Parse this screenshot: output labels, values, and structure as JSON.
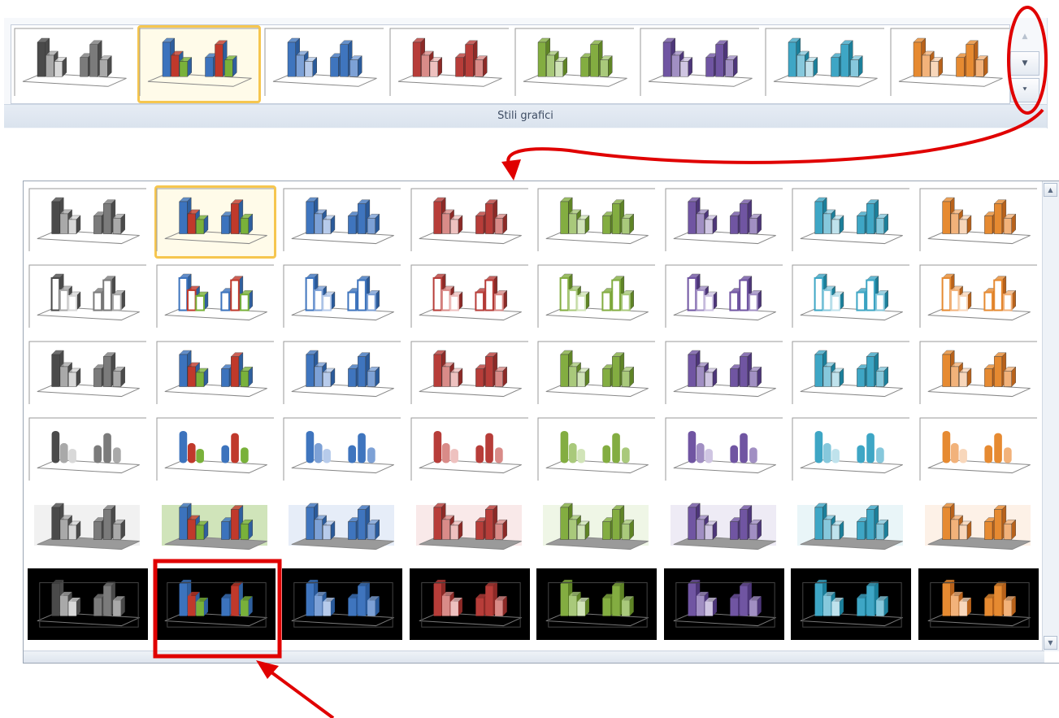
{
  "ribbon": {
    "group_caption": "Stili grafici",
    "selected_index": 1,
    "scroll_up_icon": "▲",
    "scroll_down_icon": "▼",
    "more_icon": "⯆"
  },
  "gallery": {
    "rows": 6,
    "cols": 8,
    "selected": {
      "row": 0,
      "col": 1
    },
    "highlighted": {
      "row": 5,
      "col": 1
    },
    "row_styles": [
      "plain",
      "outline",
      "plain-dark",
      "cylinder",
      "tinted-wall",
      "black"
    ],
    "scroll_up_icon": "▲",
    "scroll_down_icon": "▼"
  },
  "palettes": [
    {
      "name": "grigio",
      "dark": "#4a4a4a",
      "main": "#7b7b7b",
      "light": "#a9a9a9",
      "pale": "#d8d8d8"
    },
    {
      "name": "multicolore",
      "dark": "#2f5f9e",
      "main": "#3c73bd",
      "light": "#c0392b",
      "pale": "#79b13a"
    },
    {
      "name": "blu",
      "dark": "#2a5a9a",
      "main": "#3f75be",
      "light": "#7da1d6",
      "pale": "#b7cbeb"
    },
    {
      "name": "rosso",
      "dark": "#8c2a27",
      "main": "#b73d39",
      "light": "#d98b88",
      "pale": "#eec1bf"
    },
    {
      "name": "verde",
      "dark": "#5f8426",
      "main": "#83ad41",
      "light": "#a9c97b",
      "pale": "#d1e4b8"
    },
    {
      "name": "viola",
      "dark": "#4d3679",
      "main": "#7055a2",
      "light": "#a18fc3",
      "pale": "#cfc5e2"
    },
    {
      "name": "azzurro",
      "dark": "#1c7f9a",
      "main": "#3ea6c5",
      "light": "#86c8dc",
      "pale": "#bfe2ec"
    },
    {
      "name": "arancio",
      "dark": "#b8621b",
      "main": "#e68a31",
      "light": "#f2b27a",
      "pale": "#f8d7bb"
    }
  ],
  "annotation_color": "#e00000"
}
